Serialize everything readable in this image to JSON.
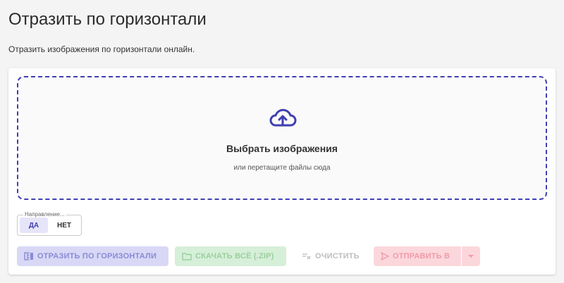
{
  "page": {
    "title": "Отразить по горизонтали",
    "subtitle": "Отразить изображения по горизонтали онлайн."
  },
  "dropzone": {
    "icon": "cloud-upload-icon",
    "title": "Выбрать изображения",
    "hint": "или перетащите файлы сюда",
    "border_color": "#3f3fb0"
  },
  "direction": {
    "legend": "Направление...",
    "options": [
      "ДА",
      "НЕТ"
    ],
    "selected": "ДА"
  },
  "actions": {
    "flip_label": "ОТРАЗИТЬ ПО ГОРИЗОНТАЛИ",
    "download_label": "СКАЧАТЬ ВСЁ (.ZIP)",
    "clear_label": "ОЧИСТИТЬ",
    "send_label": "ОТПРАВИТЬ В"
  },
  "colors": {
    "accent": "#3f3fb0",
    "flip_bg": "#d8d8f6",
    "download_bg": "#d6efd8",
    "send_bg": "#fbd7dc"
  }
}
